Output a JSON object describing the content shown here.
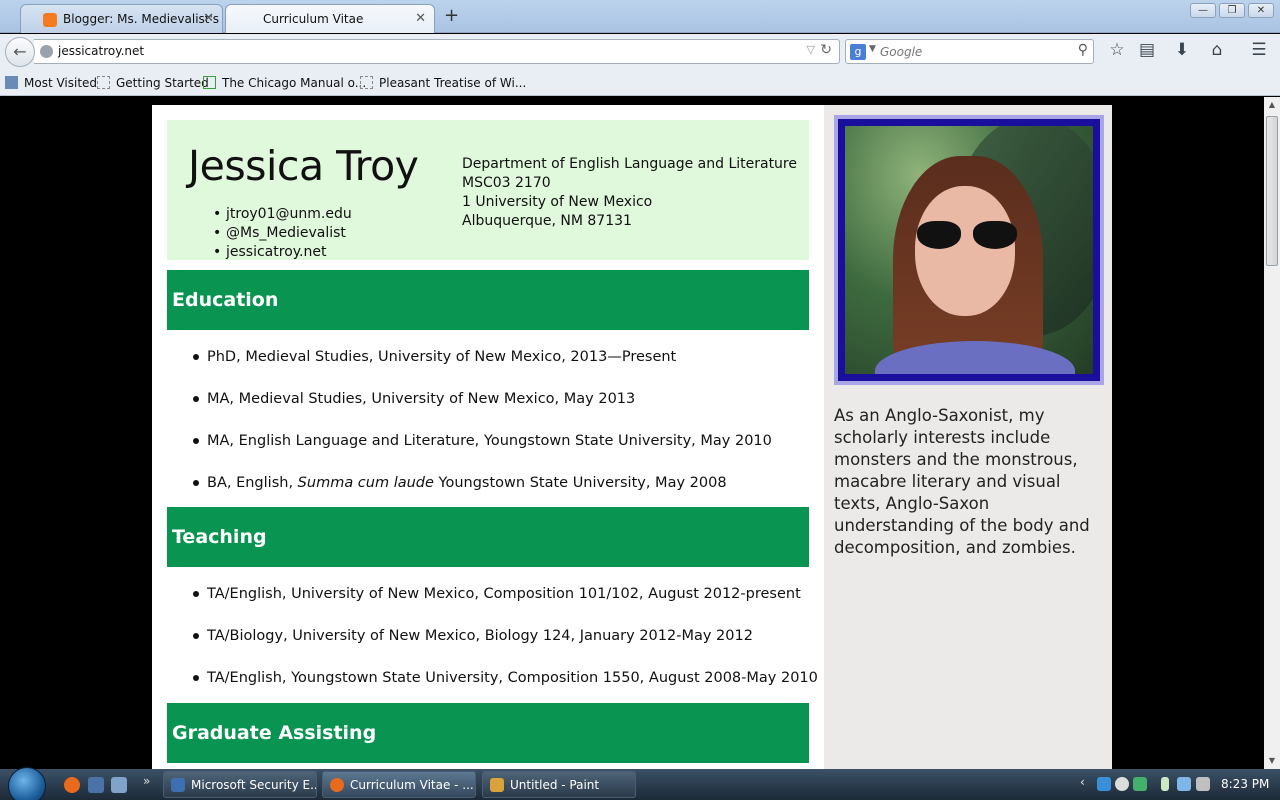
{
  "browser": {
    "tabs": [
      {
        "label": "Blogger: Ms. Medievalist's ...",
        "icon": "blogger-icon",
        "color": "#f47b20",
        "active": false
      },
      {
        "label": "Curriculum Vitae",
        "icon": "",
        "color": "",
        "active": true
      }
    ],
    "url": "jessicatroy.net",
    "search_placeholder": "Google",
    "bookmarks": [
      "Most Visited",
      "Getting Started",
      "The Chicago Manual o...",
      "Pleasant Treatise of Wi..."
    ]
  },
  "cv": {
    "name": "Jessica Troy",
    "contacts": [
      "jtroy01@unm.edu",
      "@Ms_Medievalist",
      "jessicatroy.net"
    ],
    "address": [
      "Department of English Language and Literature",
      "MSC03 2170",
      "1 University of New Mexico",
      "Albuquerque, NM 87131"
    ],
    "sections": {
      "education": {
        "title": "Education",
        "items": [
          {
            "text": "PhD, Medieval Studies, University of New Mexico, 2013—Present"
          },
          {
            "text": "MA, Medieval Studies, University of New Mexico, May 2013"
          },
          {
            "text": "MA, English Language and Literature, Youngstown State University, May 2010"
          },
          {
            "text_before": "BA, English, ",
            "text_italic": "Summa cum laude",
            "text_after": " Youngstown State University, May 2008"
          }
        ]
      },
      "teaching": {
        "title": "Teaching",
        "items": [
          {
            "text": "TA/English, University of New Mexico, Composition 101/102, August 2012-present"
          },
          {
            "text": "TA/Biology, University of New Mexico, Biology 124, January 2012-May 2012"
          },
          {
            "text": "TA/English, Youngstown State University, Composition 1550, August 2008-May 2010"
          }
        ]
      },
      "graduate": {
        "title": "Graduate Assisting"
      }
    },
    "bio": "As an Anglo-Saxonist, my scholarly interests include monsters and the monstrous, macabre literary and visual texts, Anglo-Saxon understanding of the body and decomposition, and zombies.",
    "colors": {
      "header_bg": "#e0f8dc",
      "section_bg": "#0a9452",
      "sidebar_bg": "#ebeae8",
      "frame": "#1a0f9c"
    }
  },
  "taskbar": {
    "buttons": [
      {
        "label": "Microsoft Security E...",
        "active": false
      },
      {
        "label": "Curriculum Vitae - ...",
        "active": true
      },
      {
        "label": "Untitled - Paint",
        "active": false
      }
    ],
    "clock": "8:23 PM"
  }
}
